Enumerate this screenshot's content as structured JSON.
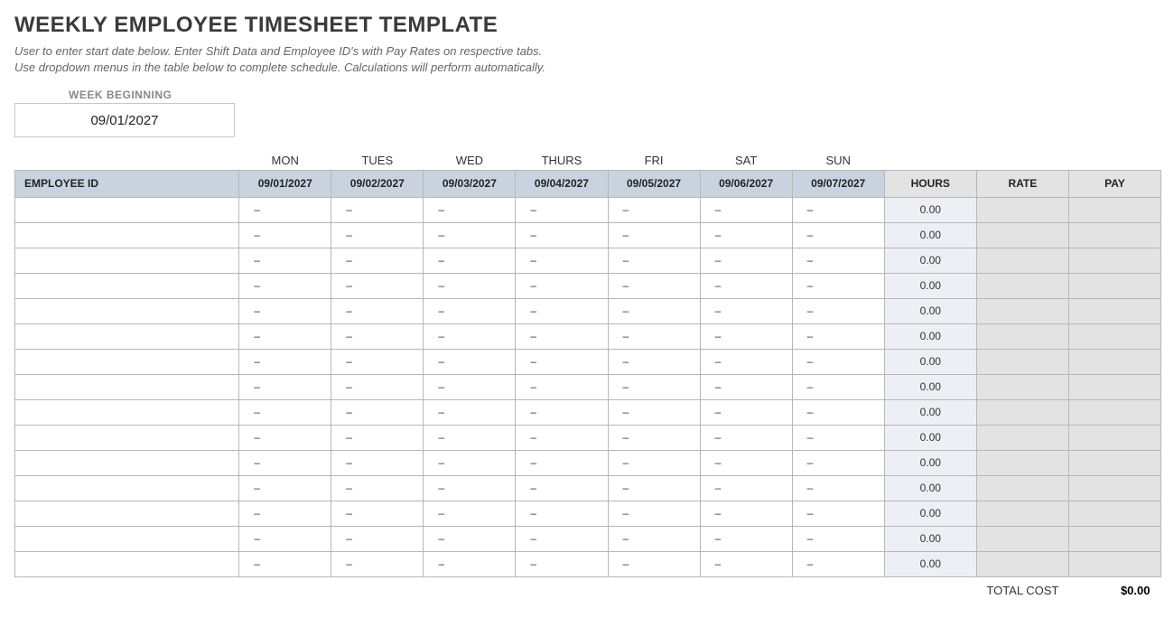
{
  "title": "WEEKLY EMPLOYEE TIMESHEET TEMPLATE",
  "instructions_line1": "User to enter start date below.  Enter Shift Data and Employee ID's with Pay Rates on respective tabs.",
  "instructions_line2": "Use dropdown menus in the table below to complete schedule. Calculations will perform automatically.",
  "week_beginning_label": "WEEK BEGINNING",
  "week_beginning_value": "09/01/2027",
  "days": [
    "MON",
    "TUES",
    "WED",
    "THURS",
    "FRI",
    "SAT",
    "SUN"
  ],
  "dates": [
    "09/01/2027",
    "09/02/2027",
    "09/03/2027",
    "09/04/2027",
    "09/05/2027",
    "09/06/2027",
    "09/07/2027"
  ],
  "headers": {
    "employee_id": "EMPLOYEE ID",
    "hours": "HOURS",
    "rate": "RATE",
    "pay": "PAY"
  },
  "placeholder_dash": "–",
  "default_hours": "0.00",
  "row_count": 15,
  "total_label": "TOTAL COST",
  "total_value": "$0.00"
}
